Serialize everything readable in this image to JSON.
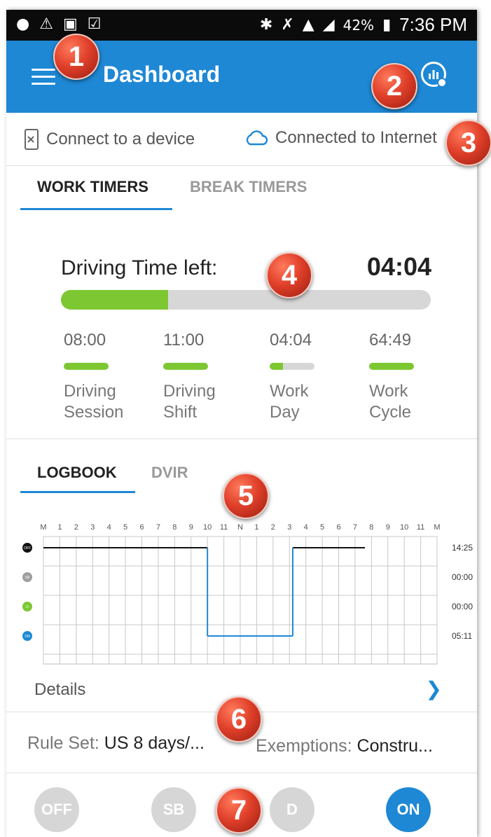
{
  "status_bar": {
    "battery_percent": "42%",
    "time": "7:36 PM",
    "left_icons": [
      "alert-icon",
      "warning-icon",
      "image-icon",
      "clipboard-icon"
    ],
    "right_icons": [
      "bluetooth-icon",
      "mute-icon",
      "wifi-icon",
      "signal-icon",
      "battery-icon"
    ]
  },
  "app_bar": {
    "title": "Dashboard",
    "menu_icon": "hamburger-icon",
    "action_icon": "stats-icon",
    "color": "#1e88d5"
  },
  "connection": {
    "device_label": "Connect to a device",
    "internet_label": "Connected to Internet",
    "device_icon": "phone-disconnected-icon",
    "internet_icon": "cloud-icon"
  },
  "timer_tabs": [
    "WORK TIMERS",
    "BREAK TIMERS"
  ],
  "driving": {
    "label": "Driving Time left:",
    "value": "04:04",
    "progress_fraction": 0.29
  },
  "mini_timers": [
    {
      "value": "08:00",
      "label_line1": "Driving",
      "label_line2": "Session",
      "fraction": 1.0
    },
    {
      "value": "11:00",
      "label_line1": "Driving",
      "label_line2": "Shift",
      "fraction": 1.0
    },
    {
      "value": "04:04",
      "label_line1": "Work",
      "label_line2": "Day",
      "fraction": 0.29
    },
    {
      "value": "64:49",
      "label_line1": "Work",
      "label_line2": "Cycle",
      "fraction": 1.0
    }
  ],
  "log_tabs": [
    "LOGBOOK",
    "DVIR"
  ],
  "chart_data": {
    "type": "line",
    "title": "",
    "x_ticks": [
      "M",
      "1",
      "2",
      "3",
      "4",
      "5",
      "6",
      "7",
      "8",
      "9",
      "10",
      "11",
      "N",
      "1",
      "2",
      "3",
      "4",
      "5",
      "6",
      "7",
      "8",
      "9",
      "10",
      "11",
      "M"
    ],
    "rows": [
      {
        "status": "OFF",
        "total": "14:25",
        "color": "#111111"
      },
      {
        "status": "SB",
        "total": "00:00",
        "color": "#9e9e9e"
      },
      {
        "status": "D",
        "total": "00:00",
        "color": "#7dc832"
      },
      {
        "status": "ON",
        "total": "05:11",
        "color": "#1e88d5"
      }
    ],
    "segments": [
      {
        "status": "OFF",
        "start_hour": 0,
        "end_hour": 10
      },
      {
        "status": "ON",
        "start_hour": 10,
        "end_hour": 15.2
      },
      {
        "status": "OFF",
        "start_hour": 15.2,
        "end_hour": 19.6
      }
    ]
  },
  "details": {
    "label": "Details",
    "chevron_icon": "chevron-right-icon"
  },
  "rules": {
    "rule_set_label": "Rule Set:",
    "rule_set_value": "US 8 days/...",
    "exemptions_label": "Exemptions:",
    "exemptions_value": "Constru..."
  },
  "status_buttons": [
    {
      "label": "OFF",
      "active": false
    },
    {
      "label": "SB",
      "active": false
    },
    {
      "label": "D",
      "active": false
    },
    {
      "label": "ON",
      "active": true
    }
  ],
  "callouts": [
    "1",
    "2",
    "3",
    "4",
    "5",
    "6",
    "7"
  ]
}
